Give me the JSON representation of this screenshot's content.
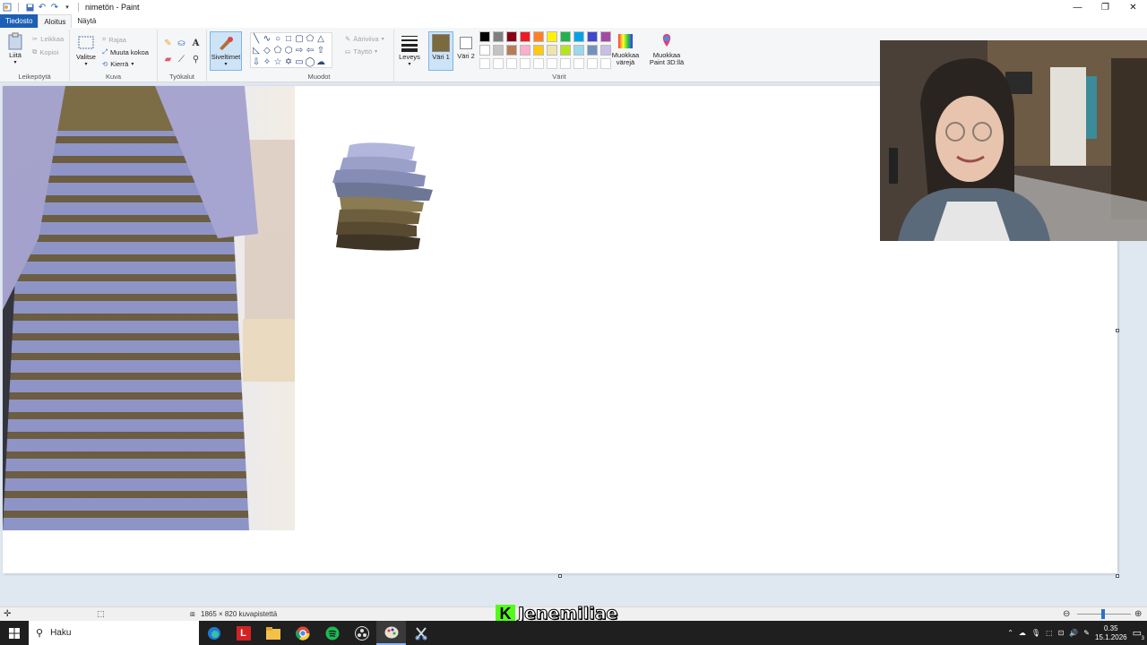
{
  "window": {
    "title": "nimetön - Paint"
  },
  "tabs": {
    "file": "Tiedosto",
    "home": "Aloitus",
    "view": "Näytä"
  },
  "ribbon": {
    "clipboard": {
      "group_label": "Leikepöytä",
      "paste": "Liitä",
      "cut": "Leikkaa",
      "copy": "Kopioi"
    },
    "image": {
      "group_label": "Kuva",
      "select": "Valitse",
      "crop": "Rajaa",
      "resize": "Muuta kokoa",
      "rotate": "Kierrä"
    },
    "tools": {
      "group_label": "Työkalut"
    },
    "brushes": {
      "label": "Siveltimet"
    },
    "shapes": {
      "group_label": "Muodot",
      "outline": "Ääriviiva",
      "fill": "Täyttö"
    },
    "size": {
      "label": "Leveys"
    },
    "colors": {
      "group_label": "Värit",
      "color1": "Väri 1",
      "color2": "Väri 2",
      "edit_colors": "Muokkaa värejä",
      "paint3d": "Muokkaa Paint 3D:llä",
      "color1_value": "#7b6a3e",
      "color2_value": "#ffffff",
      "palette_row1": [
        "#000000",
        "#7f7f7f",
        "#880015",
        "#ed1c24",
        "#ff7f27",
        "#fff200",
        "#22b14c",
        "#00a2e8",
        "#3f48cc",
        "#a349a4"
      ],
      "palette_row2": [
        "#ffffff",
        "#c3c3c3",
        "#b97a57",
        "#ffaec9",
        "#ffc90e",
        "#efe4b0",
        "#b5e61d",
        "#99d9ea",
        "#7092be",
        "#c8bfe7"
      ]
    }
  },
  "status": {
    "dimensions": "1865 × 820 kuvapistettä"
  },
  "overlay": {
    "streamer_name": "Jenemiliae"
  },
  "taskbar": {
    "search_placeholder": "Haku",
    "time": "0.35",
    "date": "15.1.2026",
    "notifications": "3"
  }
}
